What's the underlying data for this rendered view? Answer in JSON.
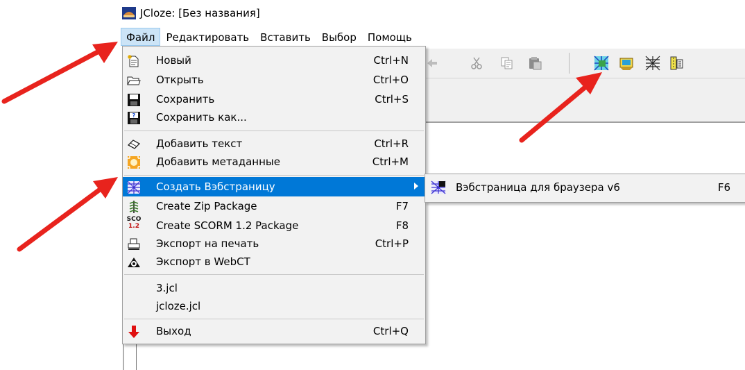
{
  "window": {
    "title": "JCloze: [Без названия]"
  },
  "menubar": {
    "items": [
      {
        "label": "Файл"
      },
      {
        "label": "Редактировать"
      },
      {
        "label": "Вставить"
      },
      {
        "label": "Выбор"
      },
      {
        "label": "Помощь"
      }
    ]
  },
  "file_menu": {
    "items": [
      {
        "label": "Новый",
        "shortcut": "Ctrl+N",
        "icon": "new-file-icon"
      },
      {
        "label": "Открыть",
        "shortcut": "Ctrl+O",
        "icon": "open-folder-icon"
      },
      {
        "label": "Сохранить",
        "shortcut": "Ctrl+S",
        "icon": "floppy-disk-icon"
      },
      {
        "label": "Сохранить как...",
        "shortcut": "",
        "icon": "save-as-icon"
      },
      {
        "label": "Добавить текст",
        "shortcut": "Ctrl+R",
        "icon": "eraser-icon"
      },
      {
        "label": "Добавить метаданные",
        "shortcut": "Ctrl+M",
        "icon": "metadata-icon"
      },
      {
        "label": "Создать Вэбстраницу",
        "shortcut": "",
        "icon": "web-icon"
      },
      {
        "label": "Create Zip Package",
        "shortcut": "F7",
        "icon": "zip-icon"
      },
      {
        "label": "Create SCORM 1.2 Package",
        "shortcut": "F8",
        "icon": "scorm-icon"
      },
      {
        "label": "Экспорт на печать",
        "shortcut": "Ctrl+P",
        "icon": "printer-icon"
      },
      {
        "label": "Экспорт в WebCT",
        "shortcut": "",
        "icon": "webct-icon"
      },
      {
        "label": "3.jcl",
        "shortcut": ""
      },
      {
        "label": "jcloze.jcl",
        "shortcut": ""
      },
      {
        "label": "Выход",
        "shortcut": "Ctrl+Q",
        "icon": "exit-arrow-icon"
      }
    ]
  },
  "submenu": {
    "label": "Вэбстраница для браузера v6",
    "shortcut": "F6",
    "icon": "web-v6-icon"
  },
  "colors": {
    "highlight": "#0078d7",
    "annotation_arrow": "#e8231d"
  }
}
